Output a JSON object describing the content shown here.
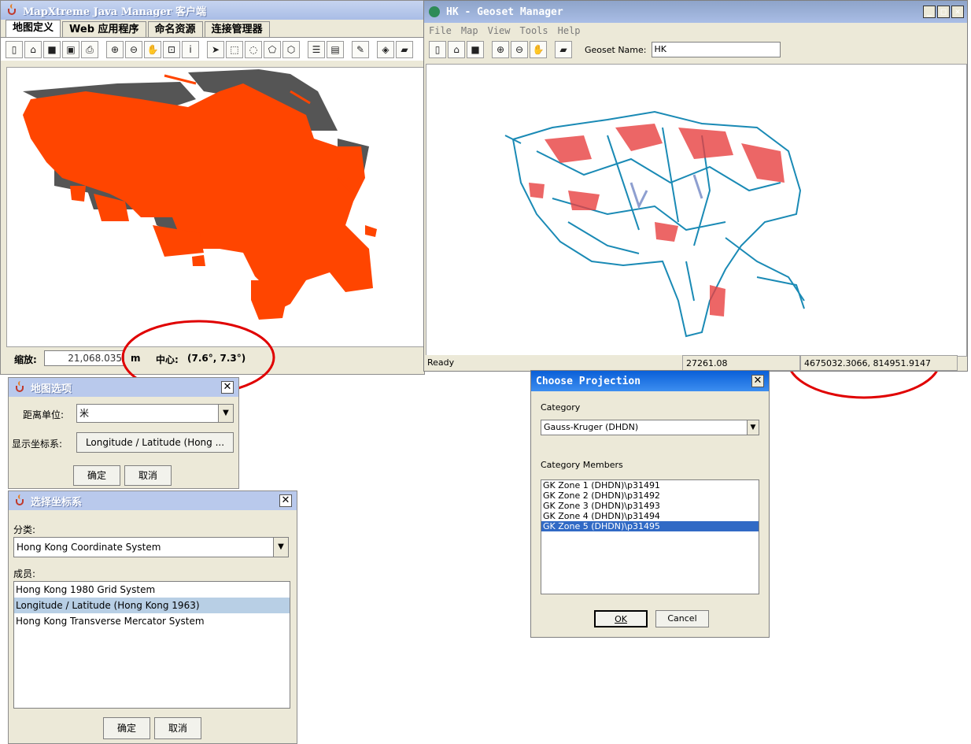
{
  "colors": {
    "land_orange": "#ff4500",
    "land_gray": "#555555",
    "geoset_blue": "#1a8ab5",
    "geoset_red": "#e84040",
    "annotation_red": "#e00000"
  },
  "manager": {
    "title": "MapXtreme Java Manager 客户端",
    "tabs": [
      "地图定义",
      "Web 应用程序",
      "命名资源",
      "连接管理器"
    ],
    "scale_label": "缩放:",
    "scale_value": "21,068.035",
    "scale_unit": "m",
    "center_label": "中心:",
    "center_value": "(7.6°, 7.3°)"
  },
  "geoset": {
    "title": "HK - Geoset Manager",
    "menu": [
      "File",
      "Map",
      "View",
      "Tools",
      "Help"
    ],
    "geoset_name_label": "Geoset Name:",
    "geoset_name_value": "HK",
    "status_ready": "Ready",
    "status_zoom": "27261.08",
    "status_coords": "4675032.3066, 814951.9147"
  },
  "map_options": {
    "title": "地图选项",
    "distance_unit_label": "距离单位:",
    "distance_unit_value": "米",
    "display_cs_label": "显示坐标系:",
    "display_cs_button": "Longitude / Latitude (Hong ...",
    "ok": "确定",
    "cancel": "取消"
  },
  "choose_cs": {
    "title": "选择坐标系",
    "category_label": "分类:",
    "category_value": "Hong Kong Coordinate System",
    "members_label": "成员:",
    "members": [
      "Hong Kong 1980 Grid System",
      "Longitude / Latitude (Hong Kong 1963)",
      "Hong Kong Transverse Mercator System"
    ],
    "selected_index": 1,
    "ok": "确定",
    "cancel": "取消"
  },
  "choose_projection": {
    "title": "Choose Projection",
    "category_label": "Category",
    "category_value": "Gauss-Kruger (DHDN)",
    "members_label": "Category Members",
    "members": [
      "GK Zone 1 (DHDN)\\p31491",
      "GK Zone 2 (DHDN)\\p31492",
      "GK Zone 3 (DHDN)\\p31493",
      "GK Zone 4 (DHDN)\\p31494",
      "GK Zone 5 (DHDN)\\p31495"
    ],
    "selected_index": 4,
    "ok": "OK",
    "cancel": "Cancel"
  }
}
